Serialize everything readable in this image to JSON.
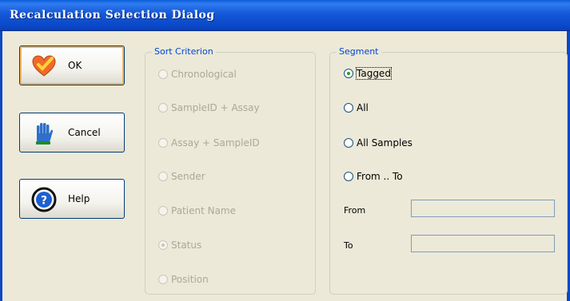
{
  "window": {
    "title": "Recalculation Selection Dialog"
  },
  "buttons": [
    {
      "label": "OK",
      "icon": "heart-check-icon"
    },
    {
      "label": "Cancel",
      "icon": "stop-hand-icon"
    },
    {
      "label": "Help",
      "icon": "question-icon"
    }
  ],
  "sort": {
    "legend": "Sort Criterion",
    "options": [
      "Chronological",
      "SampleID + Assay",
      "Assay + SampleID",
      "Sender",
      "Patient Name",
      "Status",
      "Position"
    ],
    "selected": "Status",
    "enabled": false
  },
  "segment": {
    "legend": "Segment",
    "options": [
      "Tagged",
      "All",
      "All Samples",
      "From .. To"
    ],
    "selected": "Tagged",
    "from_label": "From",
    "to_label": "To",
    "from_value": "",
    "to_value": ""
  },
  "colors": {
    "title_bar": "#0a48c8",
    "legend_text": "#0046d5",
    "radio_dot": "#21a121"
  }
}
